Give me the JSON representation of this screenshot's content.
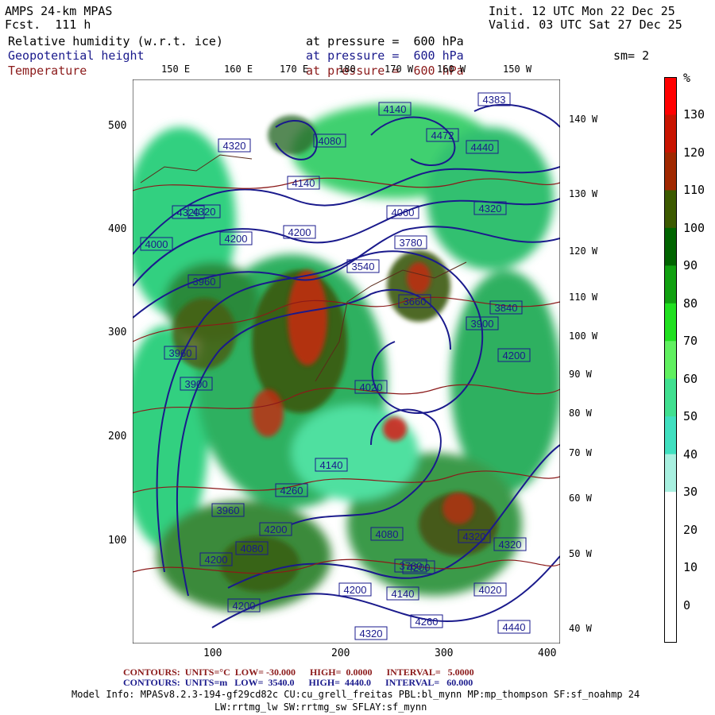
{
  "header": {
    "model": "AMPS 24-km MPAS",
    "forecast": "Fcst.  111 h",
    "init": "Init. 12 UTC Mon 22 Dec 25",
    "valid": "Valid. 03 UTC Sat 27 Dec 25",
    "smoothing": "sm= 2"
  },
  "fields": [
    {
      "name": "Relative humidity (w.r.t. ice)",
      "level": "at pressure =  600 hPa",
      "color": "#000000"
    },
    {
      "name": "Geopotential height",
      "level": "at pressure =  600 hPa",
      "color": "#1a1a8c"
    },
    {
      "name": "Temperature",
      "level": "at pressure =  600 hPa",
      "color": "#8b1a1a"
    }
  ],
  "axes": {
    "y_ticks": [
      "500",
      "400",
      "300",
      "200",
      "100"
    ],
    "x_ticks": [
      "100",
      "200",
      "300",
      "400"
    ],
    "top_lon": [
      "150 E",
      "160 E",
      "170 E",
      "180",
      "170 W",
      "160 W",
      "150 W"
    ],
    "right_lon": [
      "140 W",
      "130 W",
      "120 W",
      "110 W",
      "100 W",
      "90 W",
      "80 W",
      "70 W",
      "60 W",
      "50 W",
      "40 W"
    ]
  },
  "colorbar": {
    "unit": "%",
    "labels": [
      "130",
      "120",
      "110",
      "100",
      "90",
      "80",
      "70",
      "60",
      "50",
      "40",
      "30",
      "20",
      "10",
      "0"
    ],
    "colors": [
      "#ff0000",
      "#c81400",
      "#a02800",
      "#3c5a00",
      "#006400",
      "#10a010",
      "#20e020",
      "#60f060",
      "#40e090",
      "#40e0c0",
      "#a8f0e0",
      "#ffffff",
      "#ffffff",
      "#ffffff",
      "#ffffff"
    ]
  },
  "height_labels": [
    "4140",
    "4383",
    "4472",
    "4440",
    "4320",
    "4080",
    "4140",
    "4320",
    "4060",
    "4320",
    "4320",
    "4200",
    "3780",
    "3540",
    "4000",
    "4200",
    "3960",
    "3660",
    "3900",
    "4200",
    "3960",
    "3900",
    "4020",
    "4140",
    "4260",
    "3960",
    "4200",
    "4080",
    "4080",
    "3760",
    "4200",
    "4200",
    "4320",
    "4320",
    "4140",
    "4200",
    "4260",
    "4320",
    "4440",
    "4200",
    "4020",
    "3840"
  ],
  "footer": {
    "contours_temp": "CONTOURS:  UNITS=°C  LOW= -30.000      HIGH=  0.0000      INTERVAL=   5.0000",
    "contours_height": "CONTOURS:  UNITS=m   LOW=  3540.0      HIGH=  4440.0      INTERVAL=   60.000",
    "model_info_1": "Model Info: MPASv8.2.3-194-gf29cd82c CU:cu_grell_freitas PBL:bl_mynn MP:mp_thompson SF:sf_noahmp 24",
    "model_info_2": "LW:rrtmg_lw SW:rrtmg_sw SFLAY:sf_mynn"
  }
}
